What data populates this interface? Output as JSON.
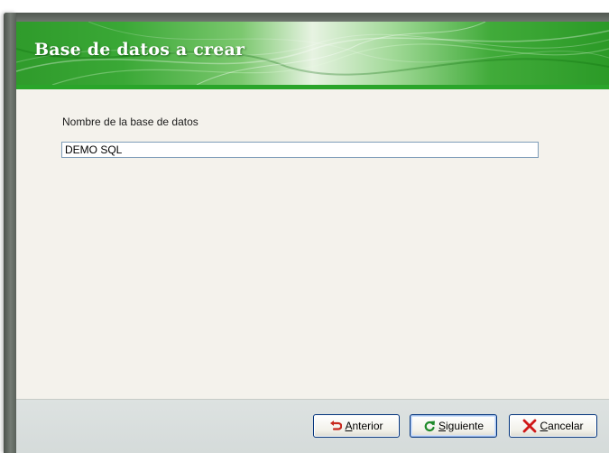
{
  "window": {
    "title": "Base de datos a crear"
  },
  "form": {
    "db_name_label": "Nombre de la base de datos",
    "db_name_value": "DEMO SQL"
  },
  "buttons": {
    "prev": {
      "mnemonic": "A",
      "rest": "nterior",
      "icon": "undo-arrow-icon"
    },
    "next": {
      "mnemonic": "S",
      "rest": "iguiente",
      "icon": "refresh-arrow-icon"
    },
    "cancel": {
      "mnemonic": "C",
      "rest": "ancelar",
      "icon": "red-x-icon"
    }
  },
  "colors": {
    "banner_green": "#2aa52a",
    "content_bg": "#f4f2ec",
    "footer_bg": "#d8dedd",
    "prev_icon": "#c8281e",
    "next_icon": "#1f8a2a",
    "cancel_icon": "#d01818"
  }
}
